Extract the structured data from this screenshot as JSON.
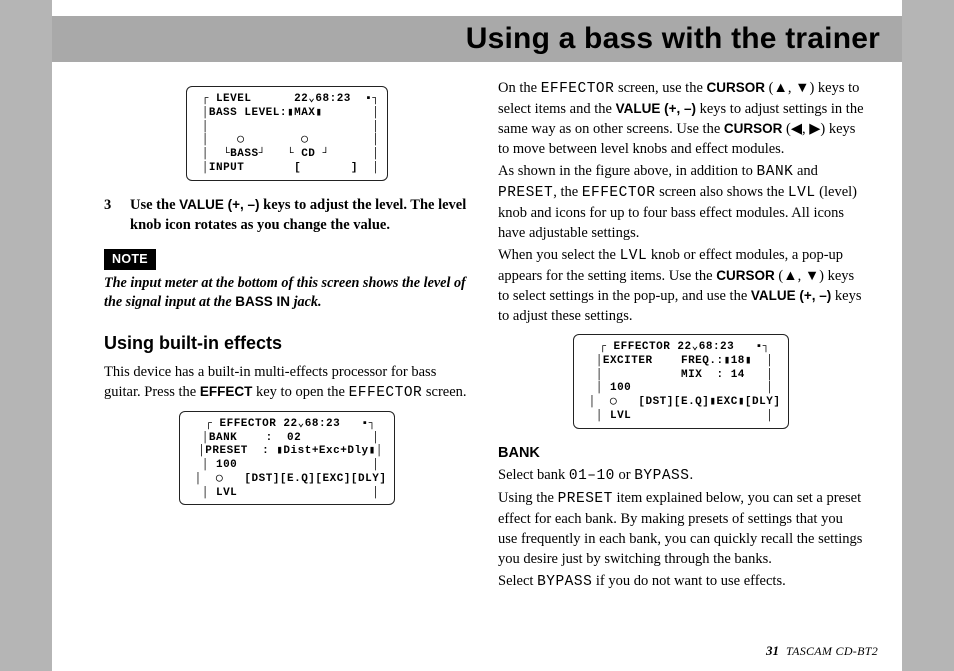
{
  "banner": {
    "title": "Using a bass with the trainer"
  },
  "left": {
    "lcd1": " ┌ LEVEL      22⌄68:23  ▪┐\n │BASS LEVEL:▮MAX▮       │\n │                       │\n │    ◯        ◯         │\n │  └BASS┘   └ CD ┘      │\n │INPUT       [       ]  │",
    "step": {
      "num": "3",
      "text_a": "Use the ",
      "value_label": "VALUE (+, –)",
      "text_b": " keys to adjust the level. The level knob icon rotates as you change the value."
    },
    "note": {
      "tag": "NOTE",
      "body_a": "The input meter at the bottom of this screen shows the level of the signal input at the ",
      "bassin": "BASS IN",
      "body_b": " jack."
    },
    "h2": "Using built-in effects",
    "para1_a": "This device has a built-in multi-effects processor for bass guitar. Press the ",
    "effect_key": "EFFECT",
    "para1_b": " key to open the ",
    "effector_word": "EFFECTOR",
    "para1_c": " screen.",
    "lcd2": " ┌ EFFECTOR 22⌄68:23   ▪┐\n │BANK    :  02          │\n │PRESET  : ▮Dist+Exc+Dly▮│\n │ 100                   │\n │  ◯   [DST][E.Q][EXC][DLY]\n │ LVL                   │"
  },
  "right": {
    "p1": {
      "a": "On the ",
      "effector": "EFFECTOR",
      "b": " screen, use the ",
      "cursor": "CURSOR",
      "c": " (▲, ▼) keys to select items and the ",
      "value": "VALUE (+, –)",
      "d": " keys to adjust settings in the same way as on other screens. Use the ",
      "cursor2": "CURSOR",
      "e": " (◀, ▶) keys to move between level knobs and effect modules."
    },
    "p2": {
      "a": "As shown in the figure above, in addition to ",
      "bank": "BANK",
      "b": " and ",
      "preset": "PRESET",
      "c": ", the ",
      "effector": "EFFECTOR",
      "d": " screen also shows the ",
      "lvl": "LVL",
      "e": " (level) knob and icons for up to four bass effect modules. All icons have adjustable settings."
    },
    "p3": {
      "a": "When you select the ",
      "lvl": "LVL",
      "b": " knob or effect modules, a pop-up appears for the setting items. Use the ",
      "cursor": "CURSOR",
      "c": " (▲, ▼) keys to select settings in the pop-up, and use the ",
      "value": "VALUE (+, –)",
      "d": " keys to adjust these settings."
    },
    "lcd3": " ┌ EFFECTOR 22⌄68:23   ▪┐\n │EXCITER    FREQ.:▮18▮  │\n │           MIX  : 14   │\n │ 100                   │\n │  ◯   [DST][E.Q]▮EXC▮[DLY]\n │ LVL                   │",
    "bank": {
      "heading": "BANK",
      "line1_a": "Select bank ",
      "range": "01–10",
      "line1_b": " or ",
      "bypass": "BYPASS",
      "line1_c": ".",
      "line2_a": "Using the ",
      "preset": "PRESET",
      "line2_b": " item explained below, you can set a preset effect for each bank. By making presets of settings that you use frequently in each bank, you can quickly recall the settings you desire just by switching through the banks.",
      "line3_a": "Select ",
      "bypass2": "BYPASS",
      "line3_b": " if you do not want to use effects."
    }
  },
  "footer": {
    "page": "31",
    "model": "TASCAM  CD-BT2"
  }
}
